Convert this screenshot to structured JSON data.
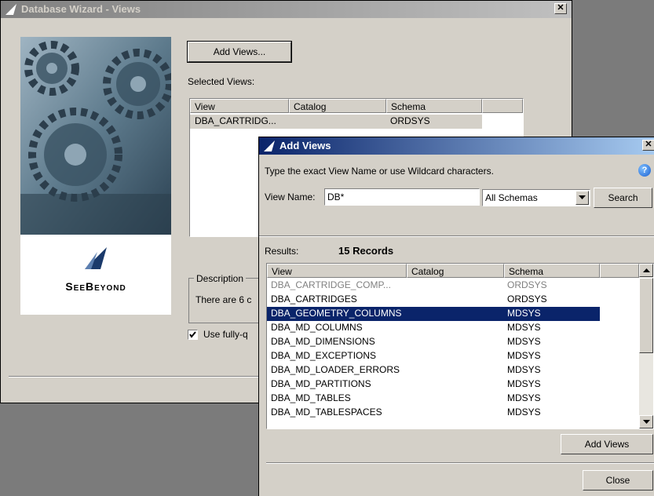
{
  "main_window": {
    "title": "Database Wizard - Views",
    "add_views_button": "Add Views...",
    "selected_views_label": "Selected Views:",
    "columns": [
      "View",
      "Catalog",
      "Schema"
    ],
    "rows": [
      {
        "view": "DBA_CARTRIDG...",
        "catalog": "",
        "schema": "ORDSYS"
      }
    ],
    "description_label": "Description",
    "description_text": "There are 6 c",
    "use_fully_label": "Use fully-q",
    "use_fully_checked": true
  },
  "branding": {
    "logo_text": "SeeBeyond"
  },
  "dialog": {
    "title": "Add Views",
    "instruction": "Type the exact View Name or use Wildcard characters.",
    "view_name_label": "View Name:",
    "view_name_value": "DB*",
    "schema_selected": "All Schemas",
    "search_button": "Search",
    "results_label": "Results:",
    "records_count": "15 Records",
    "columns": [
      "View",
      "Catalog",
      "Schema"
    ],
    "rows": [
      {
        "view": "DBA_CARTRIDGE_COMP...",
        "catalog": "",
        "schema": "ORDSYS"
      },
      {
        "view": "DBA_CARTRIDGES",
        "catalog": "",
        "schema": "ORDSYS"
      },
      {
        "view": "DBA_GEOMETRY_COLUMNS",
        "catalog": "",
        "schema": "MDSYS"
      },
      {
        "view": "DBA_MD_COLUMNS",
        "catalog": "",
        "schema": "MDSYS"
      },
      {
        "view": "DBA_MD_DIMENSIONS",
        "catalog": "",
        "schema": "MDSYS"
      },
      {
        "view": "DBA_MD_EXCEPTIONS",
        "catalog": "",
        "schema": "MDSYS"
      },
      {
        "view": "DBA_MD_LOADER_ERRORS",
        "catalog": "",
        "schema": "MDSYS"
      },
      {
        "view": "DBA_MD_PARTITIONS",
        "catalog": "",
        "schema": "MDSYS"
      },
      {
        "view": "DBA_MD_TABLES",
        "catalog": "",
        "schema": "MDSYS"
      },
      {
        "view": "DBA_MD_TABLESPACES",
        "catalog": "",
        "schema": "MDSYS"
      }
    ],
    "selected_row_index": 2,
    "add_views_button": "Add Views",
    "close_button": "Close"
  },
  "icons": {
    "close": "close-icon",
    "help": "help-icon",
    "dropdown": "chevron-down-icon",
    "scroll_up": "scroll-up-icon",
    "scroll_down": "scroll-down-icon",
    "checkbox": "checkmark-icon"
  },
  "colors": {
    "title_active": "#0a246a",
    "title_inactive": "#808080",
    "selection": "#0a246a",
    "window_bg": "#d4d0c8"
  }
}
